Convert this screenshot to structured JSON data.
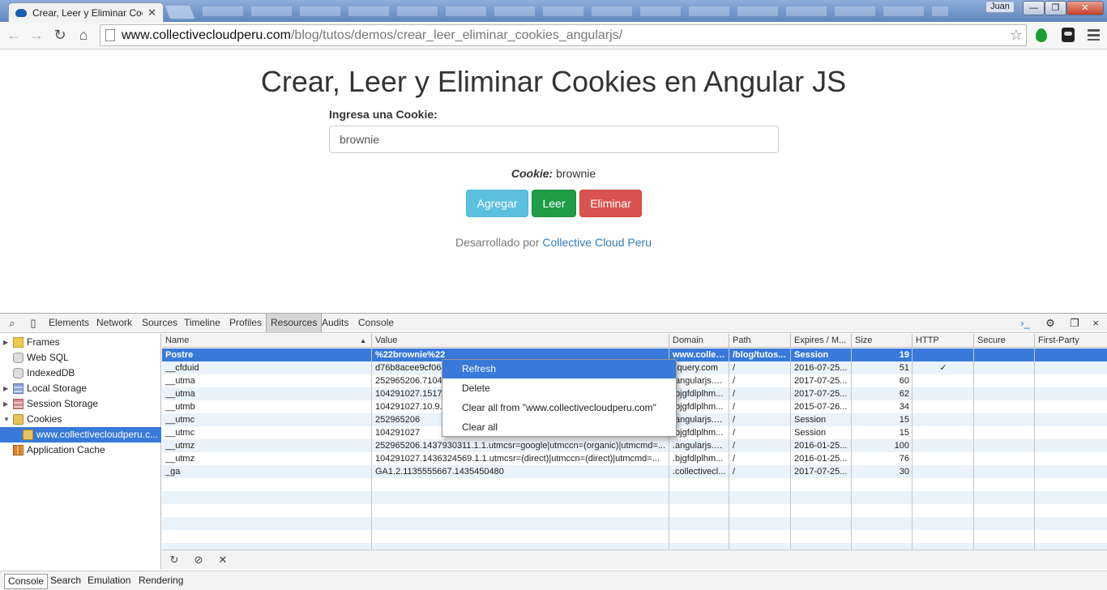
{
  "browser": {
    "tab_title": "Crear, Leer y Eliminar Coo",
    "tab_close": "✕",
    "user_name": "Juan",
    "url_host": "www.collectivecloudperu.com",
    "url_path": "/blog/tutos/demos/crear_leer_eliminar_cookies_angularjs/",
    "win_minimize": "—",
    "win_maximize": "❐",
    "win_close": "✕"
  },
  "page": {
    "title": "Crear, Leer y Eliminar Cookies en Angular JS",
    "input_label": "Ingresa una Cookie:",
    "input_value": "brownie",
    "cookie_label": "Cookie:",
    "cookie_value": "brownie",
    "buttons": {
      "add": "Agregar",
      "read": "Leer",
      "delete": "Eliminar"
    },
    "credit_prefix": "Desarrollado por",
    "credit_link": "Collective Cloud Peru"
  },
  "devtools": {
    "tabs": [
      "Elements",
      "Network",
      "Sources",
      "Timeline",
      "Profiles",
      "Resources",
      "Audits",
      "Console"
    ],
    "active_tab": "Resources",
    "sidebar": [
      "Frames",
      "Web SQL",
      "IndexedDB",
      "Local Storage",
      "Session Storage",
      "Cookies",
      "www.collectivecloudperu.c...",
      "Application Cache"
    ],
    "columns": [
      "Name",
      "Value",
      "Domain",
      "Path",
      "Expires / M...",
      "Size",
      "HTTP",
      "Secure",
      "First-Party"
    ],
    "rows": [
      {
        "name": "Postre",
        "value": "%22brownie%22",
        "domain": "www.collect...",
        "path": "/blog/tutos...",
        "expires": "Session",
        "size": "19",
        "http": "",
        "secure": "",
        "first_party": ""
      },
      {
        "name": "__cfduid",
        "value": "d76b8acee9cf064",
        "domain": ".jquery.com",
        "path": "/",
        "expires": "2016-07-25...",
        "size": "51",
        "http": "✓",
        "secure": "",
        "first_party": ""
      },
      {
        "name": "__utma",
        "value": "252965206.7104",
        "domain": ".angularjs.org",
        "path": "/",
        "expires": "2017-07-25...",
        "size": "60",
        "http": "",
        "secure": "",
        "first_party": ""
      },
      {
        "name": "__utma",
        "value": "104291027.1517",
        "domain": ".bjgfdlplhm...",
        "path": "/",
        "expires": "2017-07-25...",
        "size": "62",
        "http": "",
        "secure": "",
        "first_party": ""
      },
      {
        "name": "__utmb",
        "value": "104291027.10.9.1",
        "domain": ".bjgfdlplhm...",
        "path": "/",
        "expires": "2015-07-26...",
        "size": "34",
        "http": "",
        "secure": "",
        "first_party": ""
      },
      {
        "name": "__utmc",
        "value": "252965206",
        "domain": ".angularjs.org",
        "path": "/",
        "expires": "Session",
        "size": "15",
        "http": "",
        "secure": "",
        "first_party": ""
      },
      {
        "name": "__utmc",
        "value": "104291027",
        "domain": ".bjgfdlplhm...",
        "path": "/",
        "expires": "Session",
        "size": "15",
        "http": "",
        "secure": "",
        "first_party": ""
      },
      {
        "name": "__utmz",
        "value": "252965206.1437930311.1.1.utmcsr=google|utmccn=(organic)|utmcmd=...",
        "domain": ".angularjs.org",
        "path": "/",
        "expires": "2016-01-25...",
        "size": "100",
        "http": "",
        "secure": "",
        "first_party": ""
      },
      {
        "name": "__utmz",
        "value": "104291027.1436324569.1.1.utmcsr=(direct)|utmccn=(direct)|utmcmd=...",
        "domain": ".bjgfdlplhm...",
        "path": "/",
        "expires": "2016-01-25...",
        "size": "76",
        "http": "",
        "secure": "",
        "first_party": ""
      },
      {
        "name": "_ga",
        "value": "GA1.2.1135555667.1435450480",
        "domain": ".collectivecl...",
        "path": "/",
        "expires": "2017-07-25...",
        "size": "30",
        "http": "",
        "secure": "",
        "first_party": ""
      }
    ],
    "context_menu": [
      "Refresh",
      "Delete",
      "Clear all from \"www.collectivecloudperu.com\"",
      "Clear all"
    ],
    "drawer_tabs": [
      "Console",
      "Search",
      "Emulation",
      "Rendering"
    ],
    "drawer_active": "Console",
    "colors": {
      "selection": "#3879d9",
      "alt_row": "#eaf2fb"
    }
  }
}
